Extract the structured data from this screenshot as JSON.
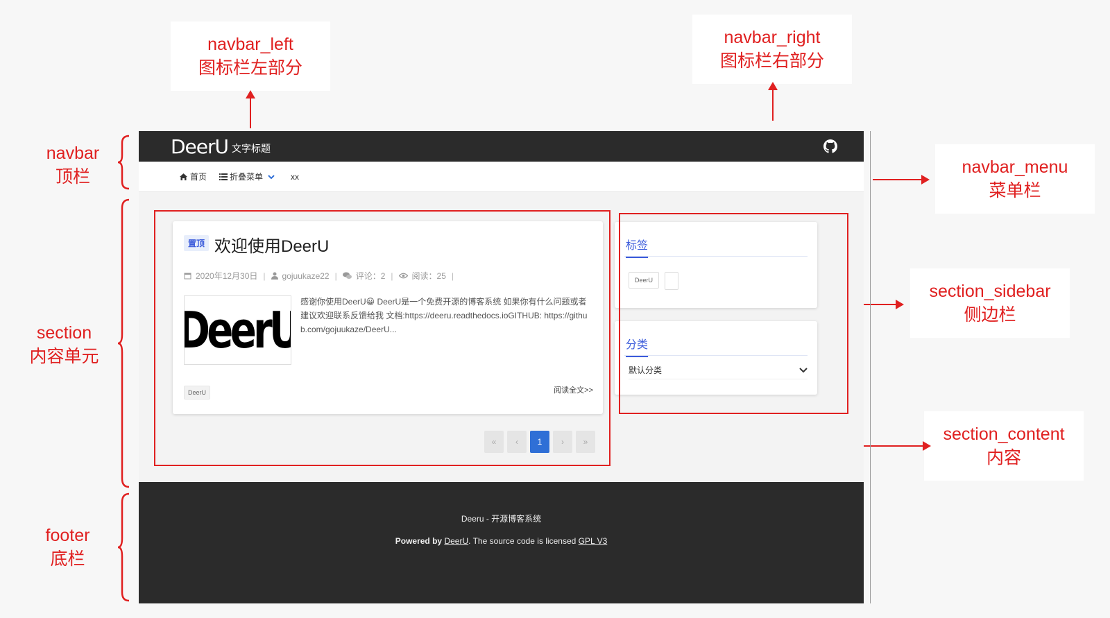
{
  "annotations": {
    "navbar_left": {
      "en": "navbar_left",
      "zh": "图标栏左部分"
    },
    "navbar_right": {
      "en": "navbar_right",
      "zh": "图标栏右部分"
    },
    "navbar_menu": {
      "en": "navbar_menu",
      "zh": "菜单栏"
    },
    "section_sidebar": {
      "en": "section_sidebar",
      "zh": "侧边栏"
    },
    "section_content": {
      "en": "section_content",
      "zh": "内容"
    },
    "navbar": {
      "en": "navbar",
      "zh": "顶栏"
    },
    "section": {
      "en": "section",
      "zh": "内容单元"
    },
    "footer": {
      "en": "footer",
      "zh": "底栏"
    }
  },
  "navbar": {
    "logo": "DeerU",
    "title": "文字标题",
    "icon": "github-icon"
  },
  "menu": {
    "items": [
      {
        "label": "首页",
        "icon": "home-icon"
      },
      {
        "label": "折叠菜单",
        "icon": "list-icon"
      },
      {
        "label": "xx"
      }
    ]
  },
  "post": {
    "pin": "置顶",
    "title": "欢迎使用DeerU",
    "date": "2020年12月30日",
    "author": "gojuukaze22",
    "comments": "评论：2",
    "views": "阅读：25",
    "thumbnail_text": "DeerU",
    "excerpt": "感谢你使用DeerU😀 DeerU是一个免费开源的博客系统 如果你有什么问题或者建议欢迎联系反馈给我 文档:https://deeru.readthedocs.ioGITHUB: https://github.com/gojuukaze/DeerU...",
    "tag": "DeerU",
    "read_more": "阅读全文>>"
  },
  "pagination": {
    "first": "«",
    "prev": "‹",
    "current": "1",
    "next": "›",
    "last": "»"
  },
  "sidebar": {
    "tags_heading": "标签",
    "tag_1": "DeerU",
    "category_heading": "分类",
    "category_selected": "默认分类"
  },
  "footer": {
    "title": "Deeru - 开源博客系统",
    "powered_prefix": "Powered by",
    "powered_link": "DeerU",
    "license_text": ". The source code is licensed",
    "license_link": "GPL V3"
  },
  "colors": {
    "annotation_red": "#e02020",
    "navbar_bg": "#2b2b2b",
    "accent_blue": "#2f6fd6"
  }
}
